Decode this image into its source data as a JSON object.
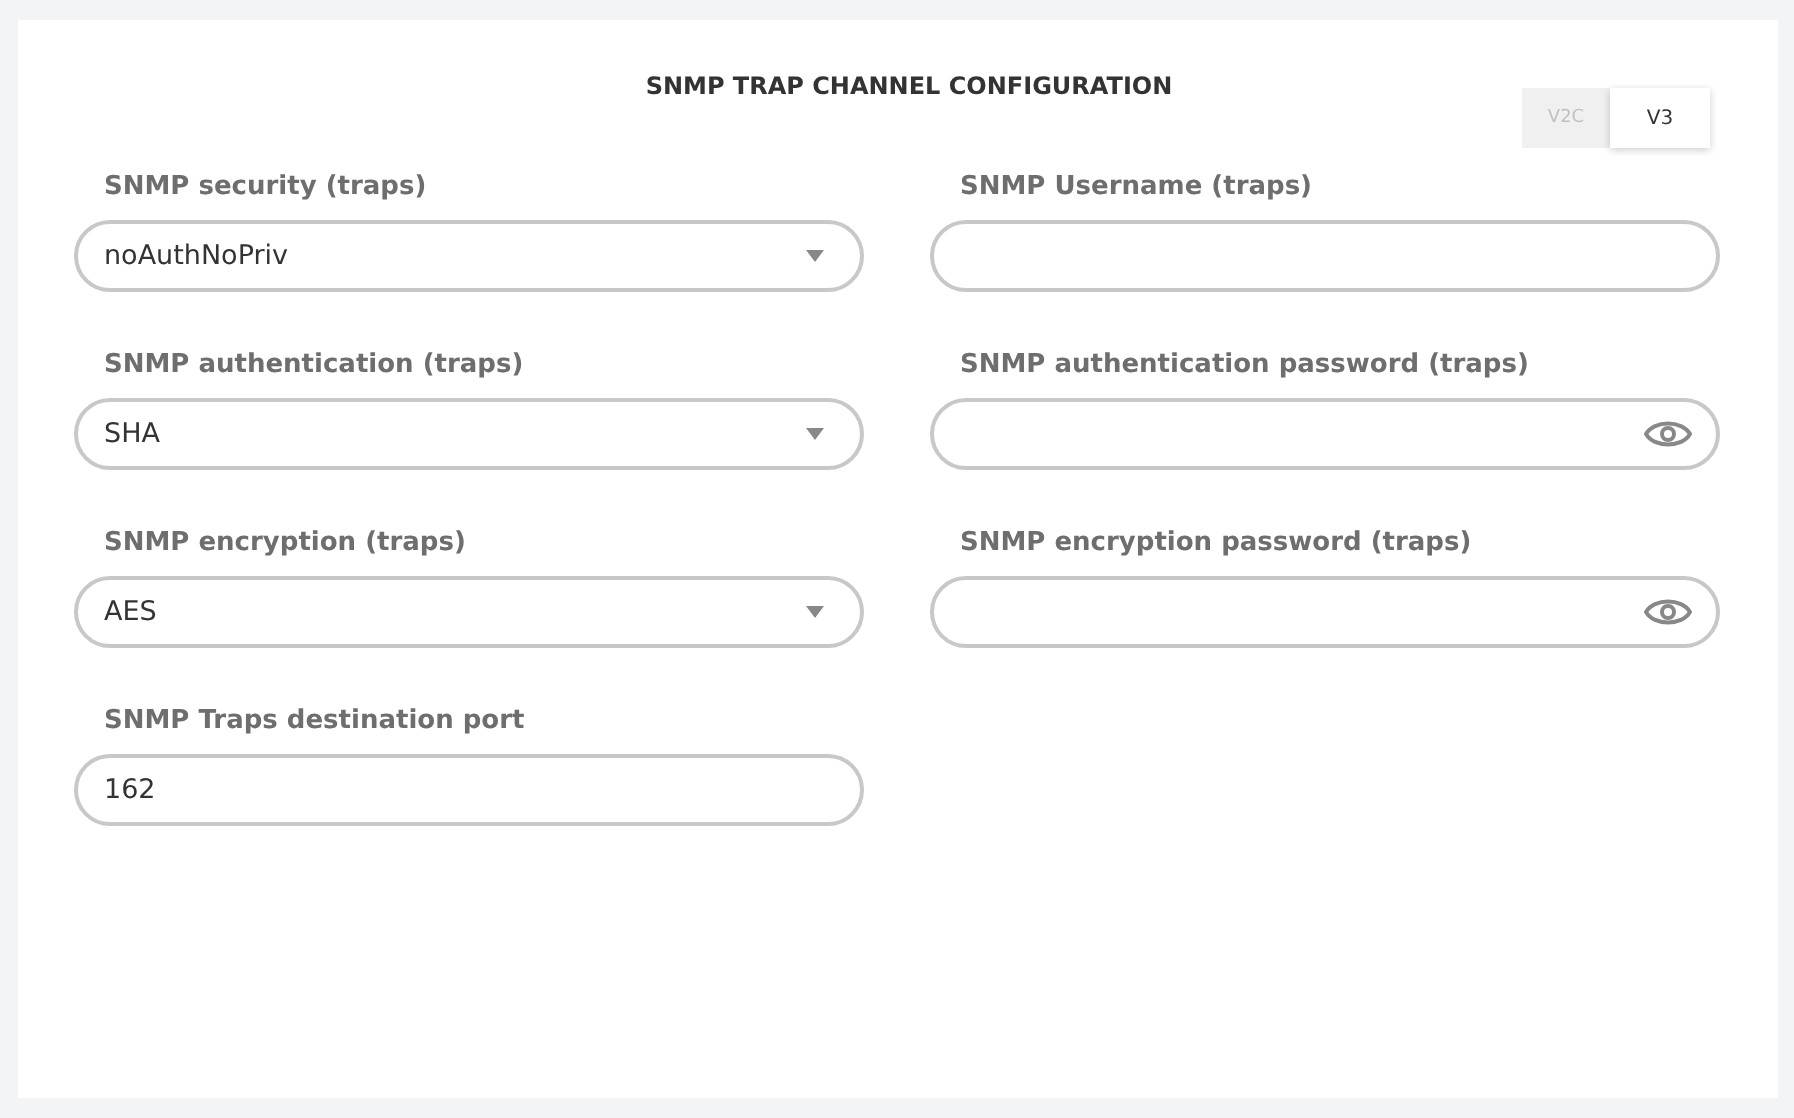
{
  "title": "SNMP TRAP CHANNEL CONFIGURATION",
  "version_toggle": [
    {
      "label": "V2C",
      "selected": false
    },
    {
      "label": "V3",
      "selected": true
    }
  ],
  "fields": [
    {
      "label": "SNMP security (traps)",
      "kind": "select",
      "value": "noAuthNoPriv"
    },
    {
      "label": "SNMP Username (traps)",
      "kind": "text"
    },
    {
      "label": "SNMP authentication (traps)",
      "kind": "select",
      "value": "SHA"
    },
    {
      "label": "SNMP authentication password (traps)",
      "kind": "password"
    },
    {
      "label": "SNMP encryption (traps)",
      "kind": "select",
      "value": "AES"
    },
    {
      "label": "SNMP encryption password (traps)",
      "kind": "password"
    },
    {
      "label": "SNMP Traps destination port",
      "kind": "text",
      "value": "162"
    }
  ]
}
